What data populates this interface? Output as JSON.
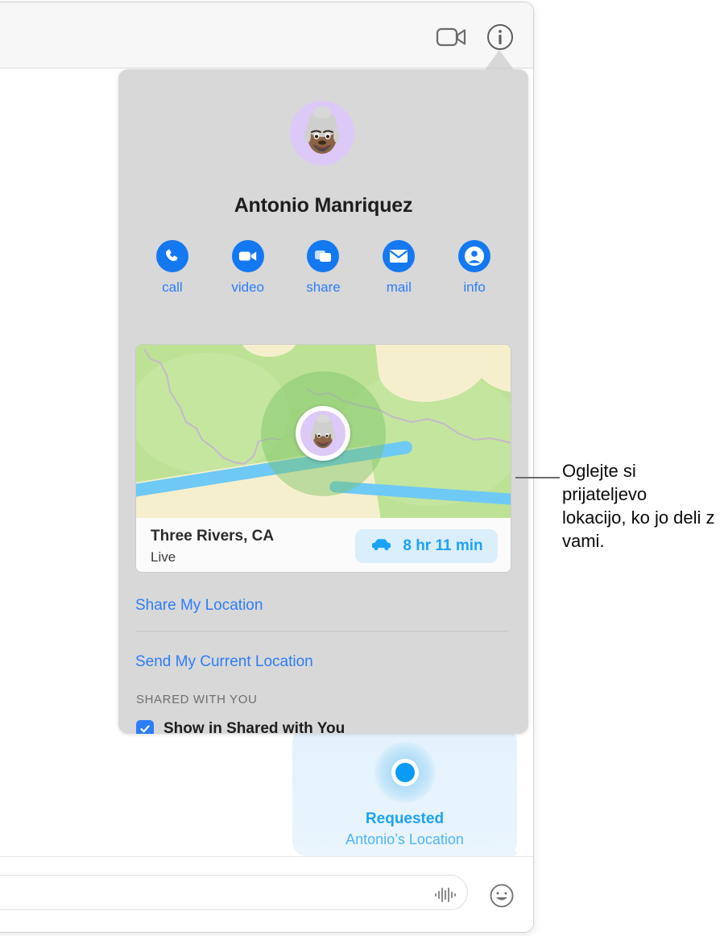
{
  "window": {
    "titlebar": {
      "video_call_icon": "video-camera-icon",
      "info_icon": "info-circle-icon"
    }
  },
  "popover": {
    "avatar": "memoji-avatar",
    "contact_name": "Antonio Manriquez",
    "actions": [
      {
        "label": "call",
        "icon": "phone-icon"
      },
      {
        "label": "video",
        "icon": "video-camera-icon"
      },
      {
        "label": "share",
        "icon": "screen-share-icon"
      },
      {
        "label": "mail",
        "icon": "envelope-icon"
      },
      {
        "label": "info",
        "icon": "person-circle-icon"
      }
    ],
    "map_card": {
      "place_name": "Three Rivers, CA",
      "status": "Live",
      "eta_icon": "car-icon",
      "eta": "8 hr 11 min",
      "pin_avatar": "memoji-avatar"
    },
    "links": {
      "share_my_location": "Share My Location",
      "send_my_current_location": "Send My Current Location"
    },
    "shared_section": {
      "header": "SHARED WITH YOU",
      "checkbox_label": "Show in Shared with You",
      "checkbox_checked": true,
      "check_icon": "checkmark-icon"
    }
  },
  "conversation": {
    "message_bubble": {
      "icon": "location-dot-icon",
      "title": "Requested",
      "subtitle": "Antonio’s Location"
    },
    "input_bar": {
      "placeholder": "",
      "value": "",
      "audio_icon": "audio-waveform-icon",
      "emoji_icon": "smiley-face-icon"
    }
  },
  "annotation": {
    "callout": "Oglejte si prijateljevo lokacijo, ko jo deli z vami."
  },
  "colors": {
    "accent_blue": "#1478f0",
    "link_blue": "#2d7df6",
    "bubble_blue": "#1aa3f8",
    "popover_gray": "#d8d8d8",
    "map_green": "#bde295",
    "map_beige": "#f6efce",
    "river_blue": "#6ec9f5",
    "avatar_purple": "#ddc9f8"
  }
}
